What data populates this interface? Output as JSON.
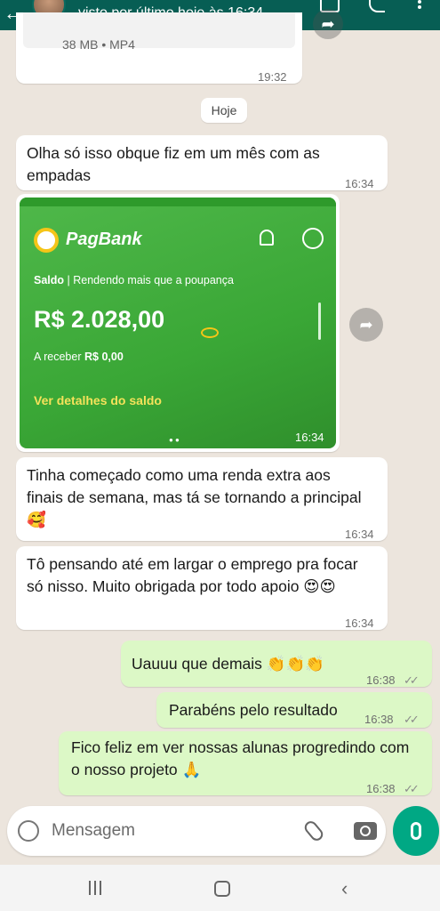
{
  "header": {
    "status": "visto por último hoje às 16:34"
  },
  "messages": {
    "video": {
      "meta": "38 MB • MP4",
      "time": "19:32"
    },
    "date_chip": "Hoje",
    "m1": {
      "text": "Olha só isso obque fiz em um mês com as empadas",
      "time": "16:34"
    },
    "image": {
      "brand": "PagBank",
      "saldo": "Saldo",
      "saldo_sub": "| Rendendo mais que a poupança",
      "amount": "R$ 2.028,00",
      "receber_label": "A receber",
      "receber_value": "R$ 0,00",
      "details_link": "Ver detalhes do saldo",
      "time": "16:34"
    },
    "m2": {
      "text": "Tinha começado como uma renda extra aos finais de semana, mas tá se tornando a principal 🥰",
      "time": "16:34"
    },
    "m3": {
      "text": "Tô pensando até em largar o emprego pra focar só nisso. Muito obrigada por todo apoio 😍😍",
      "time": "16:34"
    },
    "m4": {
      "text": "Uauuu que demais 👏👏👏",
      "time": "16:38"
    },
    "m5": {
      "text": "Parabéns pelo resultado",
      "time": "16:38"
    },
    "m6": {
      "text": "Fico feliz em ver nossas alunas progredindo com o nosso projeto 🙏",
      "time": "16:38"
    },
    "read_ticks": "✓✓"
  },
  "input": {
    "placeholder": "Mensagem"
  },
  "icons": [
    "back-arrow-icon",
    "video-call-icon",
    "phone-icon",
    "more-icon",
    "forward-icon",
    "emoji-icon",
    "attach-icon",
    "camera-icon",
    "mic-icon",
    "recent-apps-icon",
    "home-icon",
    "nav-back-icon"
  ],
  "colors": {
    "header": "#075e54",
    "outgoing": "#dcf8c6",
    "incoming": "#ffffff",
    "chat_bg": "#ece5dd",
    "pagbank_green": "#3aa736",
    "mic": "#00a884"
  }
}
